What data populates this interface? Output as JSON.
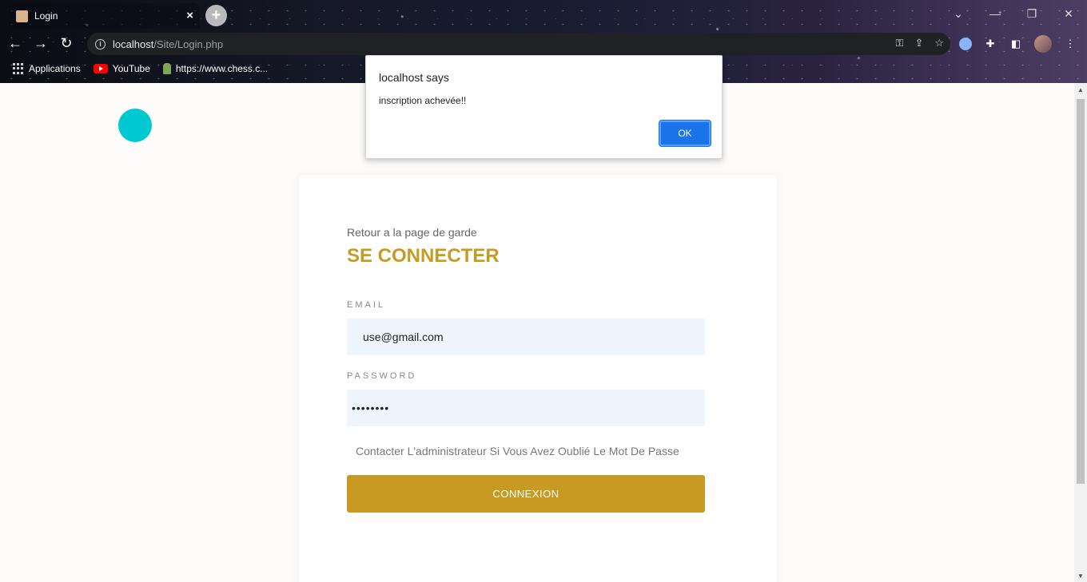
{
  "browser": {
    "tab_title": "Login",
    "tab_close_icon": "×",
    "new_tab_icon": "+",
    "url_host": "localhost",
    "url_path": "/Site/Login.php",
    "window_controls": [
      "⌄",
      "—",
      "❐",
      "✕"
    ],
    "bookmarks": [
      {
        "label": "Applications",
        "icon": "apps-grid-icon"
      },
      {
        "label": "YouTube",
        "icon": "youtube-icon"
      },
      {
        "label": "https://www.chess.c...",
        "icon": "chess-pawn-icon"
      }
    ]
  },
  "page": {
    "back_link": "Retour a la page de garde",
    "title": "SE CONNECTER",
    "email_label": "EMAIL",
    "email_value": "use@gmail.com",
    "password_label": "PASSWORD",
    "password_value": "••••••••",
    "forgot_text": "Contacter L'administrateur Si Vous Avez Oublié Le Mot De Passe",
    "connect_button": "CONNEXION"
  },
  "dialog": {
    "title": "localhost says",
    "message": "inscription achevée!!",
    "ok_label": "OK"
  },
  "colors": {
    "accent": "#c99a22",
    "input_bg": "#eef5fd",
    "dot": "#00c8d0",
    "dialog_button": "#1a73e8"
  }
}
